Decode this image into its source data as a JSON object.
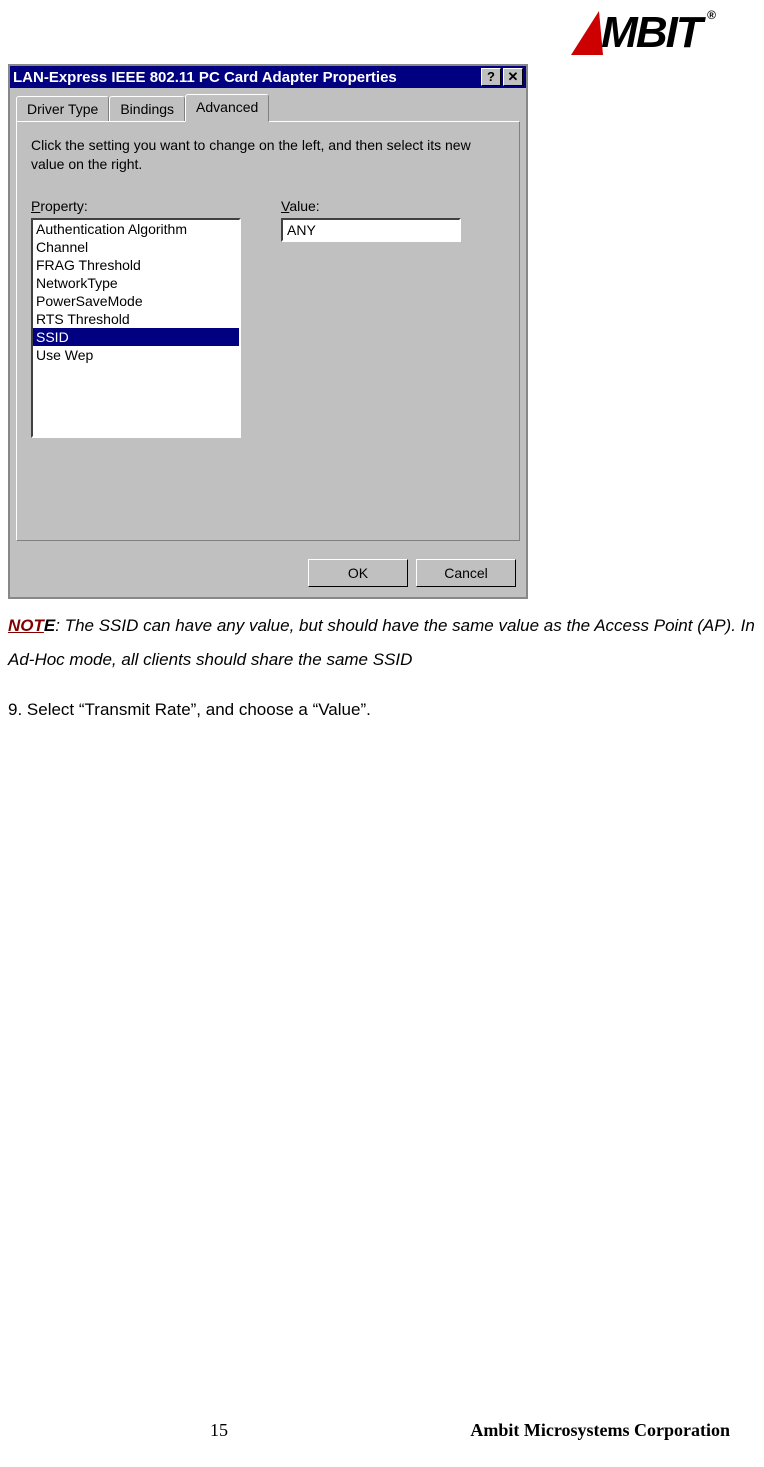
{
  "logo": {
    "text": "MBIT",
    "registered": "®"
  },
  "dialog": {
    "title": "LAN-Express IEEE 802.11 PC Card Adapter Properties",
    "help_glyph": "?",
    "close_glyph": "✕",
    "tabs": [
      {
        "label": "Driver Type"
      },
      {
        "label": "Bindings"
      },
      {
        "label": "Advanced"
      }
    ],
    "active_tab_index": 2,
    "instruction": "Click the setting you want to change on the left, and then select its new value on the right.",
    "property_label": "Property:",
    "value_label": "Value:",
    "properties": [
      "Authentication Algorithm",
      "Channel",
      "FRAG Threshold",
      "NetworkType",
      "PowerSaveMode",
      "RTS Threshold",
      "SSID",
      "Use Wep"
    ],
    "selected_property_index": 6,
    "value_text": "ANY",
    "ok_label": "OK",
    "cancel_label": "Cancel"
  },
  "document": {
    "note_label": "NOT",
    "note_label_tail": "E",
    "note_text": ": The SSID can have any value, but should have the same value as the Access Point (AP). In Ad-Hoc mode, all clients should share the same SSID",
    "step": "9. Select “Transmit Rate”, and choose a “Value”."
  },
  "footer": {
    "page_number": "15",
    "corporation": "Ambit Microsystems Corporation"
  }
}
